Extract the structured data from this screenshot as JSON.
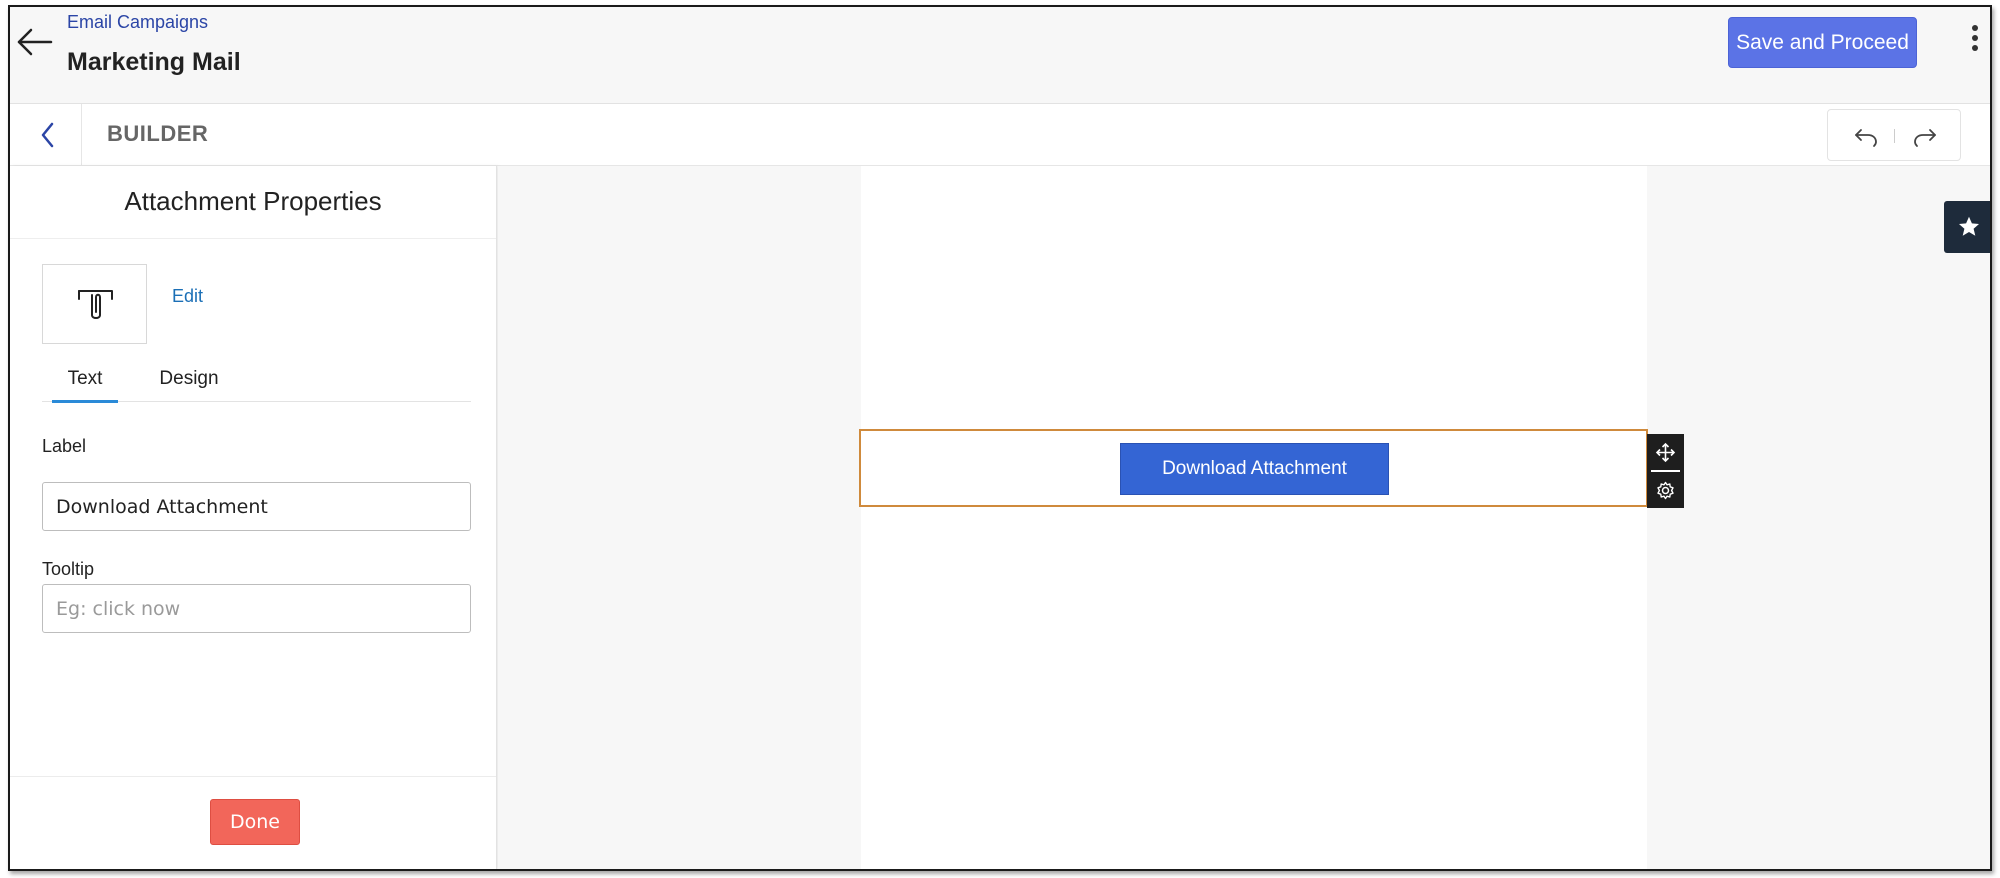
{
  "header": {
    "breadcrumb": "Email Campaigns",
    "title": "Marketing Mail",
    "save_label": "Save and Proceed"
  },
  "builder_bar": {
    "title": "BUILDER"
  },
  "panel": {
    "title": "Attachment Properties",
    "edit_label": "Edit",
    "tabs": [
      {
        "label": "Text",
        "active": true
      },
      {
        "label": "Design",
        "active": false
      }
    ],
    "label_field": {
      "label": "Label",
      "value": "Download Attachment"
    },
    "tooltip_field": {
      "label": "Tooltip",
      "value": "",
      "placeholder": "Eg: click now"
    },
    "done_label": "Done"
  },
  "canvas": {
    "button_label": "Download Attachment"
  },
  "icons": {
    "back": "arrow-left-icon",
    "builder_back": "chevron-left-icon",
    "more": "kebab-menu-icon",
    "undo": "undo-icon",
    "redo": "redo-icon",
    "attachment": "paperclip-icon",
    "move": "move-icon",
    "settings": "gear-icon",
    "favorite": "star-icon"
  },
  "colors": {
    "primary": "#5b73e6",
    "link": "#2b45a6",
    "done": "#f2665a",
    "download_button": "#3465d4",
    "selection_border": "#cf8a3c",
    "active_tab": "#2a8ad8"
  }
}
